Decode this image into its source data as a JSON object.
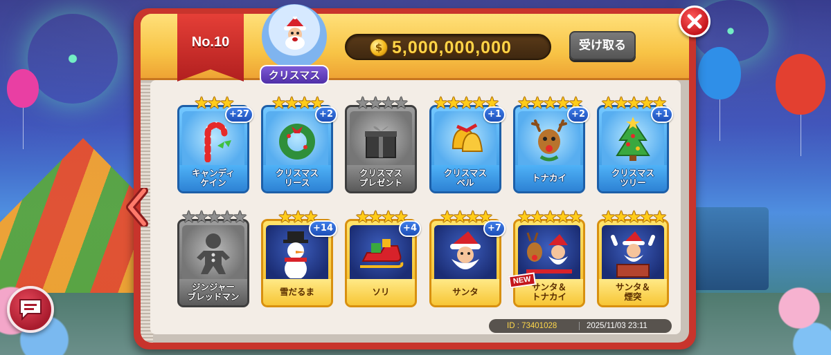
{
  "header": {
    "rank": "No.10",
    "event_name": "クリスマス",
    "coin_amount": "5,000,000,000",
    "coin_symbol": "$",
    "claim_label": "受け取る"
  },
  "cards": [
    {
      "name": "キャンディ\nケイン",
      "stars": 3,
      "max_stars": 3,
      "count": "+27",
      "style": "blue",
      "icon": "candy-cane-icon"
    },
    {
      "name": "クリスマス\nリース",
      "stars": 4,
      "max_stars": 4,
      "count": "+2",
      "style": "blue",
      "icon": "wreath-icon"
    },
    {
      "name": "クリスマス\nプレゼント",
      "stars": 0,
      "max_stars": 4,
      "count": "",
      "style": "grey",
      "icon": "gift-icon"
    },
    {
      "name": "クリスマス\nベル",
      "stars": 5,
      "max_stars": 5,
      "count": "+1",
      "style": "blue",
      "icon": "bell-icon"
    },
    {
      "name": "トナカイ",
      "stars": 5,
      "max_stars": 5,
      "count": "+2",
      "style": "blue",
      "icon": "reindeer-icon"
    },
    {
      "name": "クリスマス\nツリー",
      "stars": 5,
      "max_stars": 5,
      "count": "+1",
      "style": "blue",
      "icon": "tree-icon"
    },
    {
      "name": "ジンジャー\nブレッドマン",
      "stars": 0,
      "max_stars": 5,
      "count": "",
      "style": "grey",
      "icon": "gingerbread-icon"
    },
    {
      "name": "雪だるま",
      "stars": 3,
      "max_stars": 3,
      "count": "+14",
      "style": "gold",
      "icon": "snowman-icon"
    },
    {
      "name": "ソリ",
      "stars": 4,
      "max_stars": 4,
      "count": "+4",
      "style": "gold",
      "icon": "sleigh-icon"
    },
    {
      "name": "サンタ",
      "stars": 4,
      "max_stars": 4,
      "count": "+7",
      "style": "gold",
      "icon": "santa-icon"
    },
    {
      "name": "サンタ＆\nトナカイ",
      "stars": 5,
      "max_stars": 5,
      "count": "",
      "style": "gold",
      "icon": "santa-reindeer-icon",
      "badge": "NEW"
    },
    {
      "name": "サンタ＆\n煙突",
      "stars": 5,
      "max_stars": 5,
      "count": "",
      "style": "gold",
      "icon": "santa-chimney-icon"
    }
  ],
  "footer": {
    "id_text": "ID : 73401028",
    "timestamp": "2025/11/03 23:11"
  },
  "colors": {
    "panel_red": "#c8342c",
    "header_gold": "#f8c446",
    "coin_text": "#ffd447",
    "count_badge_blue": "#1d4fb8"
  }
}
